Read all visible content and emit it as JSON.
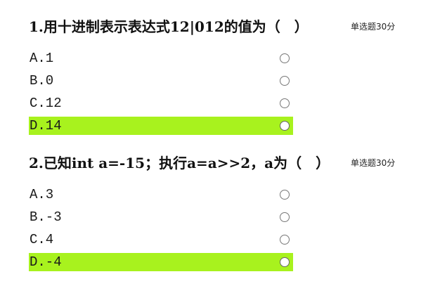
{
  "questions": [
    {
      "title": "1.用十进制表示表达式12|012的值为（　）",
      "type_label": "单选题30分",
      "options": [
        {
          "label": "A.1",
          "selected": false
        },
        {
          "label": "B.0",
          "selected": false
        },
        {
          "label": "C.12",
          "selected": false
        },
        {
          "label": "D.14",
          "selected": true
        }
      ]
    },
    {
      "title": "2.已知int a=-15；执行a=a>>2，a为（　）",
      "type_label": "单选题30分",
      "options": [
        {
          "label": "A.3",
          "selected": false
        },
        {
          "label": "B.-3",
          "selected": false
        },
        {
          "label": "C.4",
          "selected": false
        },
        {
          "label": "D.-4",
          "selected": true
        }
      ]
    }
  ],
  "colors": {
    "selected_highlight": "#a8f21e",
    "radio_border": "#777777",
    "text": "#1a1a1a"
  },
  "icons": {
    "radio": "radio-circle-icon"
  }
}
